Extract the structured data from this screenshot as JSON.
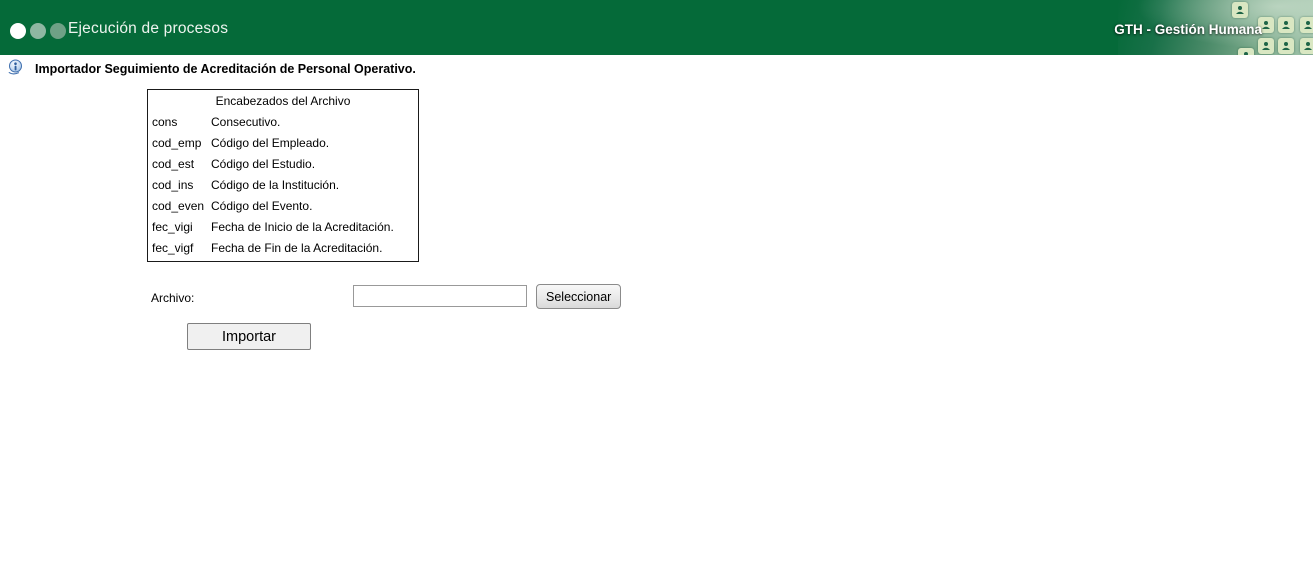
{
  "colors": {
    "header-green": "#056a39",
    "tile-bg": "#d9e7c2",
    "tile-person": "#1e6547"
  },
  "icons": {
    "dots": "three-circle-dots (white, light-green, muted-green)",
    "info": "blue-info-help-icon",
    "person_tiles": "grid of person silhouette tiles in header photo"
  },
  "header": {
    "title": "Ejecución de procesos",
    "brand": "GTH - Gestión Humana"
  },
  "page": {
    "title": "Importador Seguimiento de Acreditación de Personal Operativo."
  },
  "headers_table": {
    "title": "Encabezados del Archivo",
    "rows": [
      {
        "code": "cons",
        "desc": "Consecutivo."
      },
      {
        "code": "cod_emp",
        "desc": "Código del Empleado."
      },
      {
        "code": "cod_est",
        "desc": "Código del Estudio."
      },
      {
        "code": "cod_ins",
        "desc": "Código de la Institución."
      },
      {
        "code": "cod_even",
        "desc": "Código del Evento."
      },
      {
        "code": "fec_vigi",
        "desc": "Fecha de Inicio de la Acreditación."
      },
      {
        "code": "fec_vigf",
        "desc": "Fecha de Fin de la Acreditación."
      }
    ]
  },
  "form": {
    "file_label": "Archivo:",
    "file_value": "",
    "select_button": "Seleccionar",
    "import_button": "Importar"
  }
}
